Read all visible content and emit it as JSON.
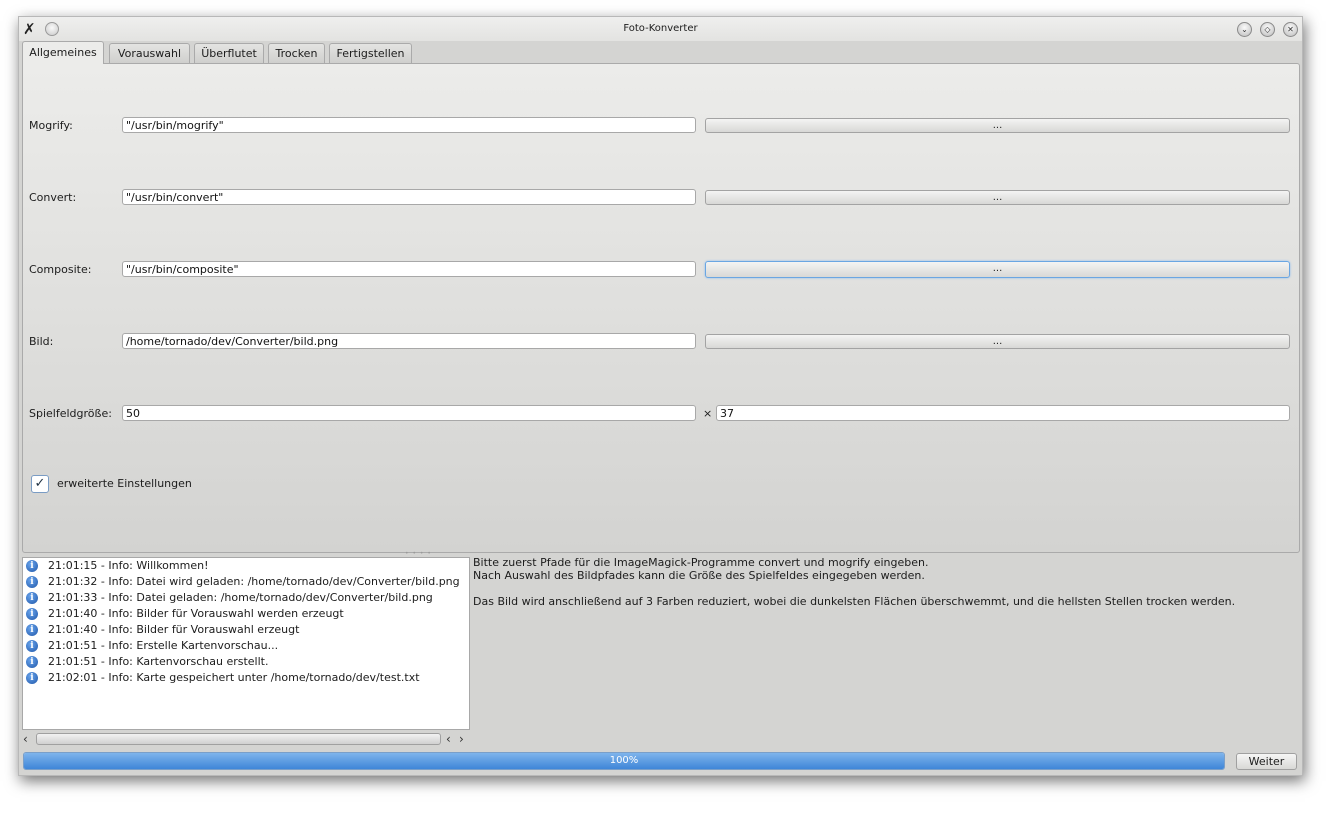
{
  "window": {
    "title": "Foto-Konverter"
  },
  "tabs": [
    {
      "label": "Allgemeines",
      "active": true
    },
    {
      "label": "Vorauswahl",
      "active": false
    },
    {
      "label": "Überflutet",
      "active": false
    },
    {
      "label": "Trocken",
      "active": false
    },
    {
      "label": "Fertigstellen",
      "active": false
    }
  ],
  "form": {
    "mogrify": {
      "label": "Mogrify:",
      "value": "\"/usr/bin/mogrify\"",
      "button": "..."
    },
    "convert": {
      "label": "Convert:",
      "value": "\"/usr/bin/convert\"",
      "button": "..."
    },
    "composite": {
      "label": "Composite:",
      "value": "\"/usr/bin/composite\"",
      "button": "..."
    },
    "bild": {
      "label": "Bild:",
      "value": "/home/tornado/dev/Converter/bild.png",
      "button": "..."
    },
    "spielfeld": {
      "label": "Spielfeldgröße:",
      "width": "50",
      "separator": "×",
      "height": "37"
    },
    "advanced": {
      "label": "erweiterte Einstellungen",
      "checked": true
    }
  },
  "log": [
    "21:01:15 - Info: Willkommen!",
    "21:01:32 - Info: Datei wird geladen: /home/tornado/dev/Converter/bild.png",
    "21:01:33 - Info: Datei geladen: /home/tornado/dev/Converter/bild.png",
    "21:01:40 - Info: Bilder für Vorauswahl werden erzeugt",
    "21:01:40 - Info: Bilder für Vorauswahl erzeugt",
    "21:01:51 - Info: Erstelle Kartenvorschau...",
    "21:01:51 - Info: Kartenvorschau erstellt.",
    "21:02:01 - Info: Karte gespeichert unter /home/tornado/dev/test.txt"
  ],
  "help": {
    "text": "Bitte zuerst Pfade für die ImageMagick-Programme convert und mogrify eingeben.\nNach Auswahl des Bildpfades kann die Größe des Spielfeldes eingegeben werden.\n\nDas Bild wird anschließend auf 3 Farben reduziert, wobei die dunkelsten Flächen überschwemmt, und die hellsten Stellen trocken werden."
  },
  "progress": {
    "value": 100,
    "label": "100%"
  },
  "footer": {
    "next_label": "Weiter"
  },
  "colors": {
    "accent": "#3f86d8",
    "window_bg": "#d4d4d2"
  }
}
